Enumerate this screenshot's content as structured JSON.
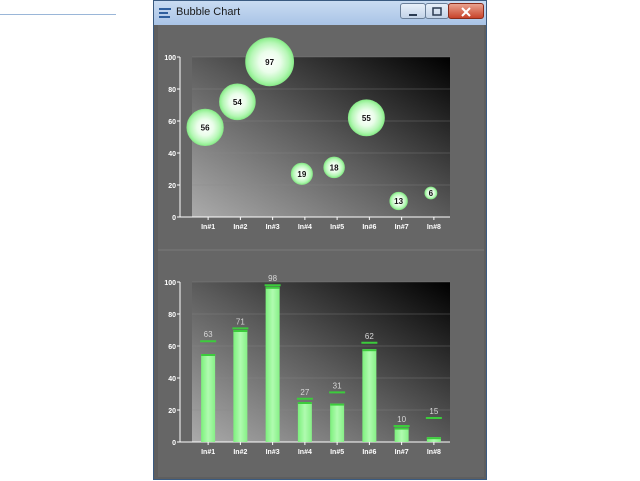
{
  "window": {
    "title": "Bubble Chart",
    "buttons": {
      "minimize": "minimize",
      "maximize": "maximize",
      "close": "close"
    }
  },
  "colors": {
    "accent": "#98f598",
    "accent_dark": "#3ccc3c",
    "plot_light": "#a8a8a8",
    "plot_dark": "#000000",
    "frame": "#666666"
  },
  "chart_data": [
    {
      "type": "scatter",
      "subtype": "bubble",
      "title": "",
      "xlabel": "",
      "ylabel": "",
      "categories": [
        "In#1",
        "In#2",
        "In#3",
        "In#4",
        "In#5",
        "In#6",
        "In#7",
        "In#8"
      ],
      "y_values": [
        56,
        72,
        97,
        27,
        31,
        62,
        10,
        15
      ],
      "sizes": [
        56,
        54,
        97,
        19,
        18,
        55,
        13,
        6
      ],
      "labels": [
        "56",
        "54",
        "97",
        "19",
        "18",
        "55",
        "13",
        "6"
      ],
      "ylim": [
        0,
        100
      ],
      "yticks": [
        "0",
        "20",
        "40",
        "60",
        "80",
        "100"
      ],
      "grid": true
    },
    {
      "type": "bar",
      "title": "",
      "xlabel": "",
      "ylabel": "",
      "categories": [
        "In#1",
        "In#2",
        "In#3",
        "In#4",
        "In#5",
        "In#6",
        "In#7",
        "In#8"
      ],
      "values": [
        55,
        70,
        97,
        25,
        24,
        58,
        9,
        3
      ],
      "markers": [
        63,
        71,
        98,
        27,
        31,
        62,
        10,
        15
      ],
      "labels": [
        "63",
        "71",
        "98",
        "27",
        "31",
        "62",
        "10",
        "15"
      ],
      "ylim": [
        0,
        100
      ],
      "yticks": [
        "0",
        "20",
        "40",
        "60",
        "80",
        "100"
      ],
      "grid": true
    }
  ]
}
